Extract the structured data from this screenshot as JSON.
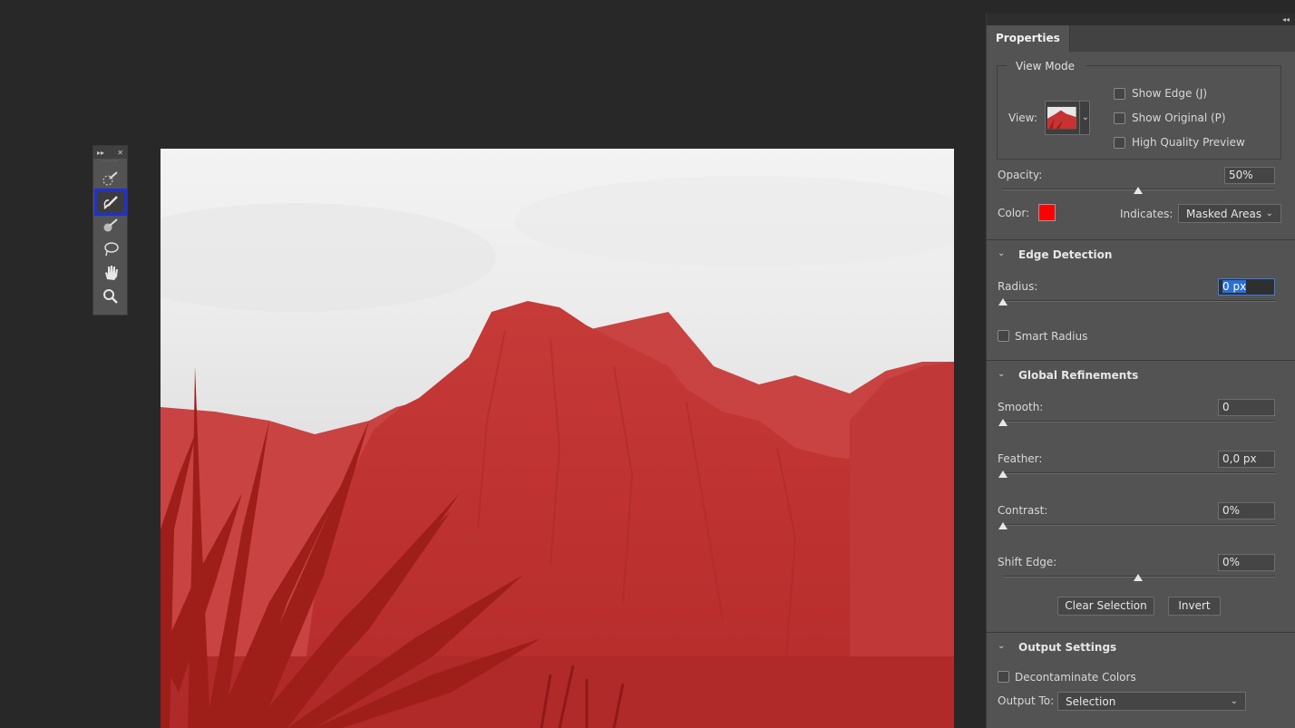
{
  "toolbar": {
    "tools": [
      {
        "name": "quick-selection-icon"
      },
      {
        "name": "refine-edge-brush-icon",
        "active": true
      },
      {
        "name": "brush-icon"
      },
      {
        "name": "lasso-icon"
      },
      {
        "name": "hand-icon"
      },
      {
        "name": "zoom-icon"
      }
    ],
    "accent_color": "#1d2fe0"
  },
  "panel": {
    "tab": "Properties",
    "view_mode": {
      "legend": "View Mode",
      "view_label": "View:",
      "show_edge": "Show Edge (J)",
      "show_original": "Show Original (P)",
      "high_quality_preview": "High Quality Preview"
    },
    "opacity": {
      "label": "Opacity:",
      "value": "50%",
      "level": 0.5
    },
    "color": {
      "label": "Color:",
      "swatch": "#ff0000"
    },
    "indicates": {
      "label": "Indicates:",
      "value": "Masked Areas"
    },
    "edge_detection": {
      "title": "Edge Detection",
      "radius_label": "Radius:",
      "radius_value_selected": "0 px",
      "radius_level": 0,
      "smart_radius": "Smart Radius"
    },
    "global_refinements": {
      "title": "Global Refinements",
      "smooth": {
        "label": "Smooth:",
        "value": "0",
        "level": 0
      },
      "feather": {
        "label": "Feather:",
        "value": "0,0 px",
        "level": 0
      },
      "contrast": {
        "label": "Contrast:",
        "value": "0%",
        "level": 0
      },
      "shift_edge": {
        "label": "Shift Edge:",
        "value": "0%",
        "level": 0.5
      },
      "clear_selection": "Clear Selection",
      "invert": "Invert"
    },
    "output_settings": {
      "title": "Output Settings",
      "decontaminate": "Decontaminate Colors",
      "output_to_label": "Output To:",
      "output_to_value": "Selection"
    }
  }
}
